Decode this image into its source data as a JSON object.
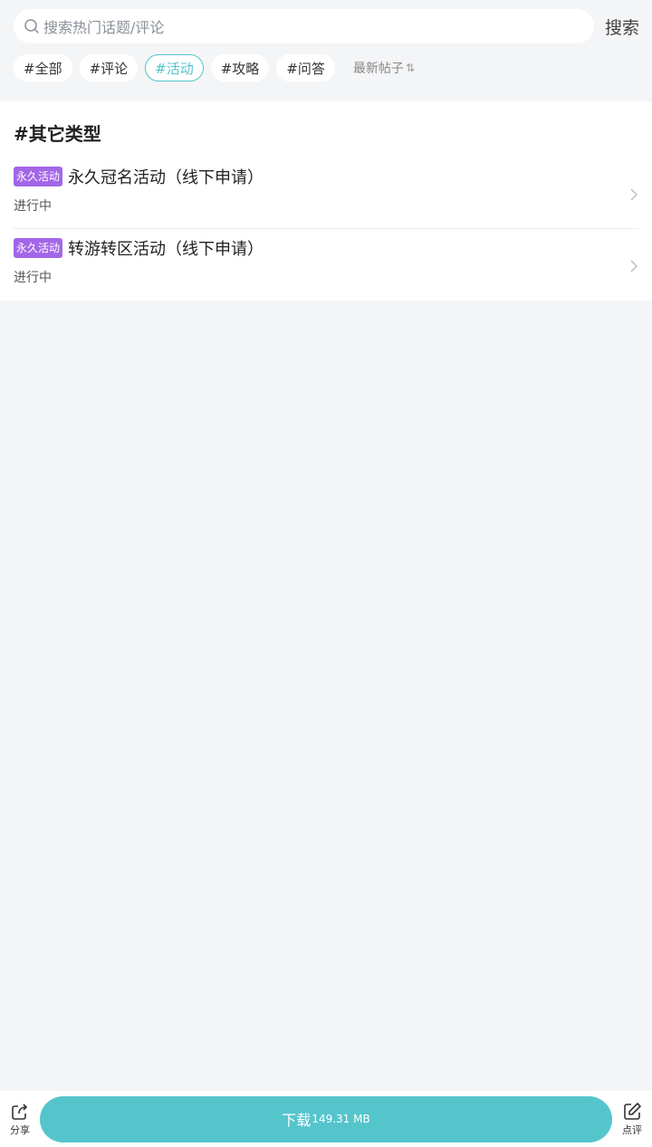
{
  "search": {
    "placeholder": "搜索热门话题/评论",
    "button_label": "搜索"
  },
  "tags": [
    {
      "label": "#全部",
      "active": false
    },
    {
      "label": "#评论",
      "active": false
    },
    {
      "label": "#活动",
      "active": true
    },
    {
      "label": "#攻略",
      "active": false
    },
    {
      "label": "#问答",
      "active": false
    }
  ],
  "sort": {
    "label": "最新帖子",
    "icon": "sort-arrows-icon"
  },
  "section": {
    "title": "#其它类型",
    "posts": [
      {
        "badge": "永久活动",
        "title": "永久冠名活动（线下申请）",
        "status": "进行中"
      },
      {
        "badge": "永久活动",
        "title": "转游转区活动（线下申请）",
        "status": "进行中"
      }
    ]
  },
  "bottom_bar": {
    "share_label": "分享",
    "download_label": "下载",
    "download_size": "149.31 MB",
    "review_label": "点评"
  },
  "colors": {
    "accent": "#53c4cb",
    "badge": "#a366e8",
    "background": "#f4f5f7"
  }
}
